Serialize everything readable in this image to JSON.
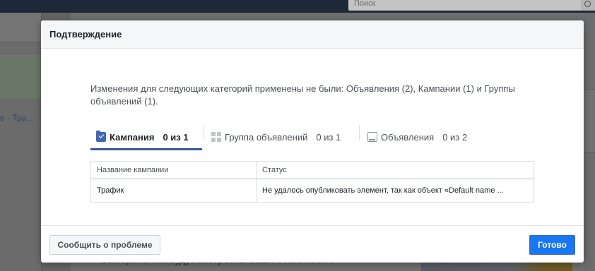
{
  "background": {
    "search": {
      "placeholder": "Поиск"
    },
    "left_link": "е - Тра...",
    "bottom_text": "Выберите, как будут построены ваши объявления."
  },
  "modal": {
    "title": "Подтверждение",
    "message": "Изменения для следующих категорий применены не были: Объявления (2), Кампании (1) и Группы объявлений (1).",
    "tabs": [
      {
        "label": "Кампания",
        "count": "0 из 1",
        "icon": "folder-check-icon",
        "active": true
      },
      {
        "label": "Группа объявлений",
        "count": "0 из 1",
        "icon": "grid-icon",
        "active": false
      },
      {
        "label": "Объявления",
        "count": "0 из 2",
        "icon": "ad-icon",
        "active": false
      }
    ],
    "table": {
      "headers": [
        "Название кампании",
        "Статус"
      ],
      "rows": [
        [
          "Трафик",
          "Не удалось опубликовать элемент, так как объект «Default name ..."
        ]
      ]
    },
    "footer": {
      "report_label": "Сообщить о проблеме",
      "done_label": "Готово"
    }
  },
  "colors": {
    "accent": "#4267b2",
    "primary_button": "#1877f2",
    "overlay": "#6f6f6f"
  }
}
